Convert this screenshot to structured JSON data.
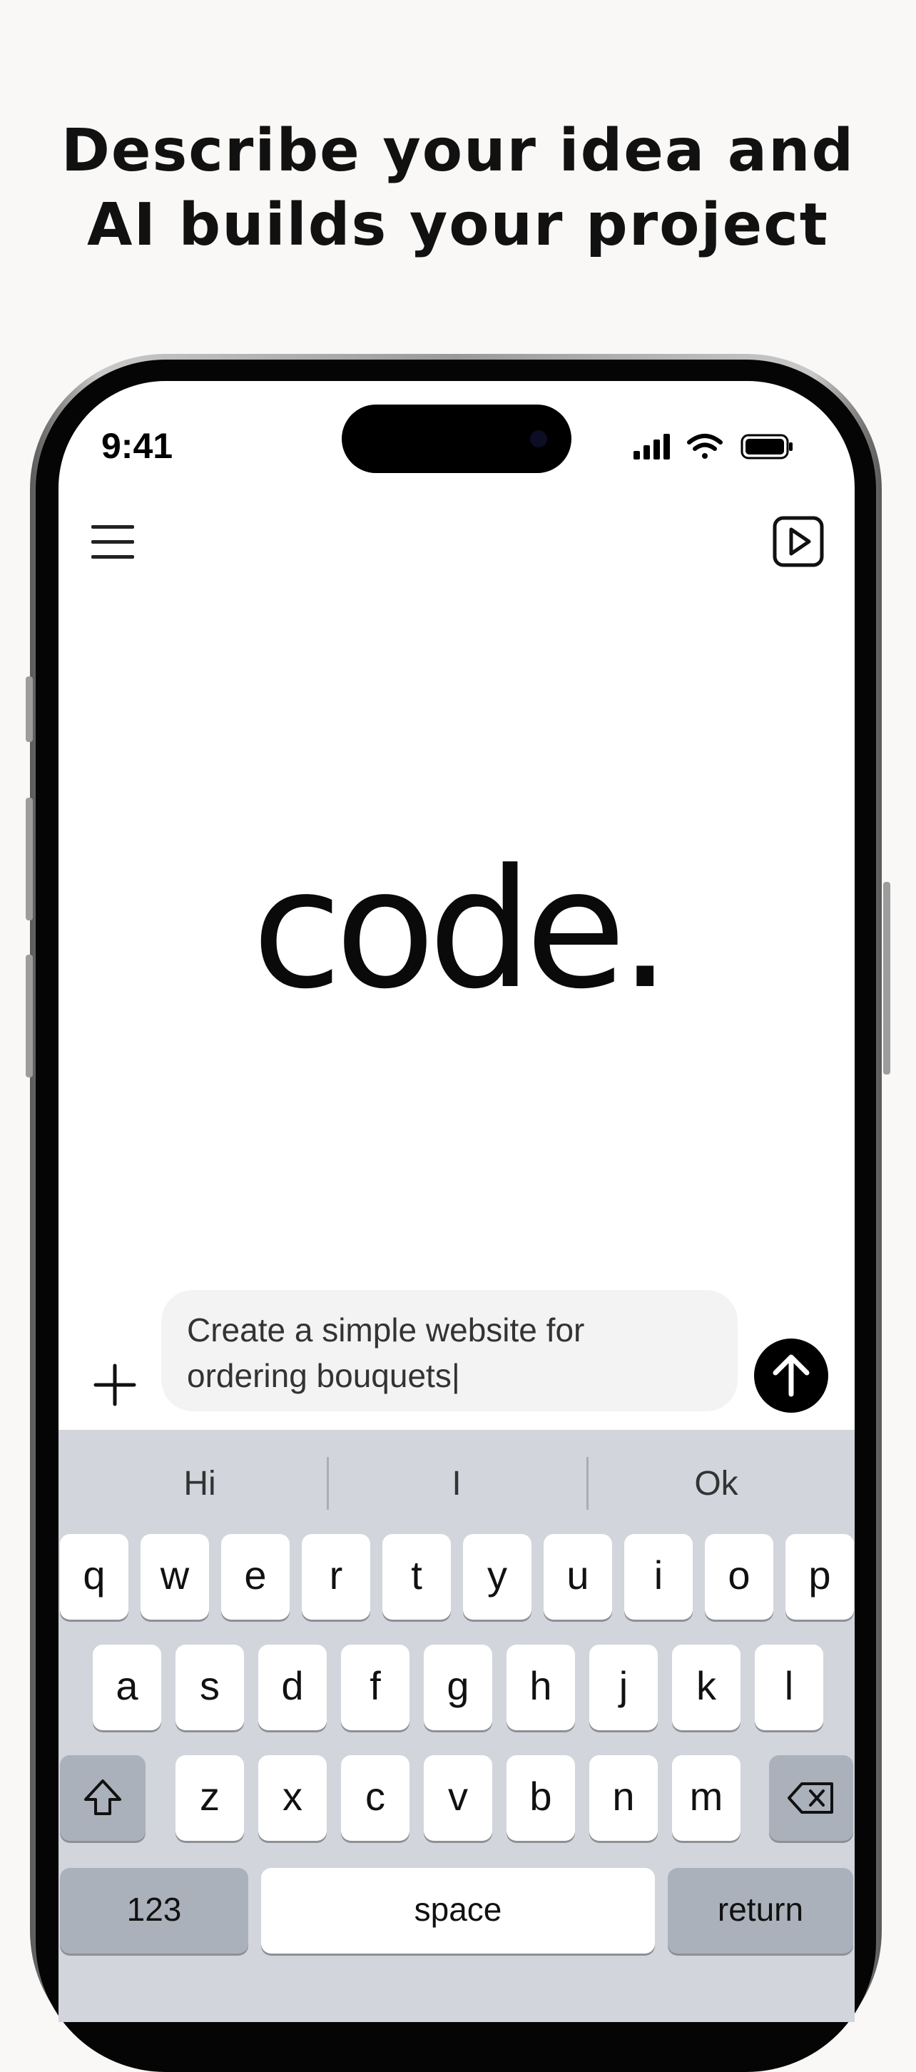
{
  "headline": {
    "line1": "Describe your idea and",
    "line2": "AI builds your project"
  },
  "status_bar": {
    "time": "9:41",
    "icons": [
      "cellular-signal-icon",
      "wifi-icon",
      "battery-icon"
    ]
  },
  "app": {
    "logo": "code.",
    "menu_icon": "hamburger-menu-icon",
    "preview_icon": "play-icon"
  },
  "composer": {
    "attach_icon": "plus-icon",
    "prompt_line1": "Create a simple website for",
    "prompt_line2": "ordering bouquets|",
    "send_icon": "arrow-up-icon"
  },
  "keyboard": {
    "suggestions": [
      "Hi",
      "I",
      "Ok"
    ],
    "row1": [
      "q",
      "w",
      "e",
      "r",
      "t",
      "y",
      "u",
      "i",
      "o",
      "p"
    ],
    "row2": [
      "a",
      "s",
      "d",
      "f",
      "g",
      "h",
      "j",
      "k",
      "l"
    ],
    "row3": [
      "z",
      "x",
      "c",
      "v",
      "b",
      "n",
      "m"
    ],
    "shift_icon": "shift-icon",
    "delete_icon": "delete-backspace-icon",
    "numbers_label": "123",
    "space_label": "space",
    "return_label": "return"
  },
  "colors": {
    "page_background": "#f9f8f6",
    "keyboard_background": "#d2d5db",
    "prompt_background": "#f3f3f3",
    "send_button": "#000000"
  }
}
